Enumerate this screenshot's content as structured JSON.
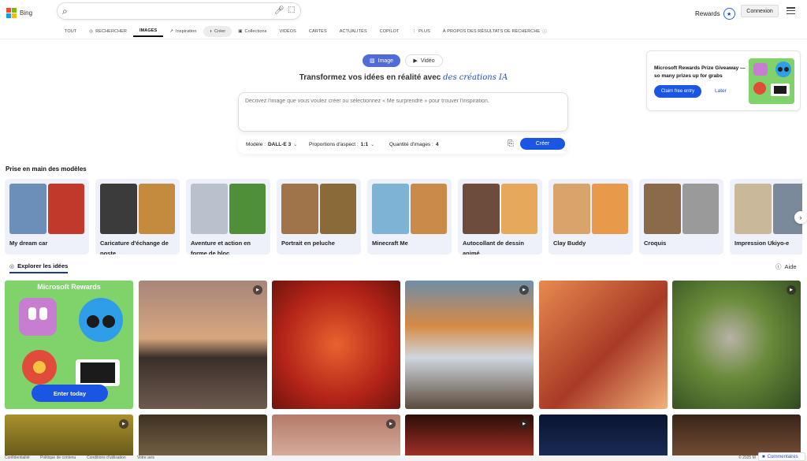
{
  "header": {
    "brand": "Bing",
    "search": {
      "value": "",
      "placeholder": ""
    },
    "rewards_label": "Rewards",
    "signin_label": "Connexion"
  },
  "nav": [
    {
      "label": "TOUT",
      "icon": ""
    },
    {
      "label": "RECHERCHER",
      "icon": "copilot-search-icon"
    },
    {
      "label": "IMAGES",
      "icon": ""
    },
    {
      "label": "Inspiration",
      "icon": "inspiration-icon"
    },
    {
      "label": "Créer",
      "icon": "create-icon"
    },
    {
      "label": "Collections",
      "icon": "collections-icon"
    },
    {
      "label": "VIDÉOS",
      "icon": ""
    },
    {
      "label": "CARTES",
      "icon": ""
    },
    {
      "label": "ACTUALITÉS",
      "icon": ""
    },
    {
      "label": "COPILOT",
      "icon": ""
    },
    {
      "label": "PLUS",
      "icon": "more-icon"
    },
    {
      "label": "À PROPOS DES RÉSULTATS DE RECHERCHE",
      "icon": "info-icon"
    }
  ],
  "toggle": {
    "image_label": "Image",
    "video_label": "Vidéo"
  },
  "headline": {
    "text": "Transformez vos idées en réalité avec",
    "brand": "des créations IA"
  },
  "prompt": {
    "placeholder": "Décrivez l'image que vous voulez créer ou sélectionnez « Me surprendre » pour trouver l'inspiration.",
    "value": ""
  },
  "options": {
    "model_label": "Modèle : ",
    "model_value": "DALL-E 3",
    "aspect_label": "Proportions d'aspect : ",
    "aspect_value": "1:1",
    "count_label": "Quantité d'images : ",
    "count_value": "4",
    "create_label": "Créer"
  },
  "promo": {
    "title": "Microsoft Rewards Prize Giveaway — so many prizes up for grabs",
    "claim_label": "Claim free entry",
    "later_label": "Later"
  },
  "models_section": {
    "title": "Prise en main des modèles",
    "cards": [
      {
        "label": "My dream car",
        "colors": [
          "#6b8fb8",
          "#c0392b"
        ]
      },
      {
        "label": "Caricature d'échange de poste",
        "colors": [
          "#3b3b3b",
          "#c48a3d"
        ]
      },
      {
        "label": "Aventure et action en forme de bloc",
        "colors": [
          "#b9c2cc",
          "#4f8f3a"
        ]
      },
      {
        "label": "Portrait en peluche",
        "colors": [
          "#a0744a",
          "#8b6a3a"
        ]
      },
      {
        "label": "Minecraft Me",
        "colors": [
          "#7fb3d5",
          "#c98a4a"
        ]
      },
      {
        "label": "Autocollant de dessin animé",
        "colors": [
          "#6d4c3d",
          "#e6a85a"
        ]
      },
      {
        "label": "Clay Buddy",
        "colors": [
          "#d9a46b",
          "#e89a4a"
        ]
      },
      {
        "label": "Croquis",
        "colors": [
          "#8a6a4a",
          "#9a9a9a"
        ]
      },
      {
        "label": "Impression Ukiyo-e",
        "colors": [
          "#c9b89a",
          "#7a8a9a"
        ]
      }
    ]
  },
  "explore": {
    "title": "Explorer les idées",
    "help_label": "Aide",
    "promo_title": "Microsoft Rewards",
    "promo_button": "Enter today"
  },
  "footer": {
    "links": [
      "Confidentialité",
      "Politique de contenu",
      "Conditions d'utilisation",
      "Votre avis"
    ],
    "copyright": "© 2025 M",
    "feedback_label": "Commentaires"
  },
  "colors": {
    "accent": "#1a55e3",
    "toggle_on": "#4f6bdc",
    "card_bg": "#eef1f9"
  }
}
